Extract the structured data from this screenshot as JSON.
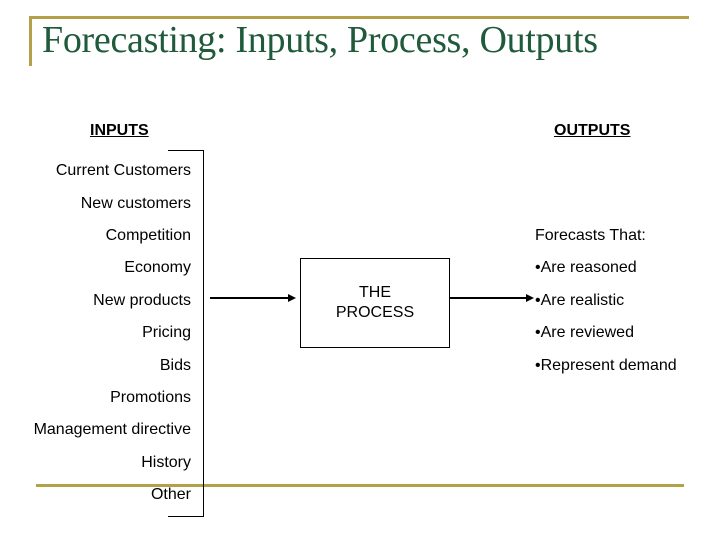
{
  "title": "Forecasting: Inputs, Process, Outputs",
  "inputs": {
    "heading": "INPUTS",
    "items": [
      "Current Customers",
      "New customers",
      "Competition",
      "Economy",
      "New products",
      "Pricing",
      "Bids",
      "Promotions",
      "Management directive",
      "History",
      "Other"
    ]
  },
  "process": {
    "line1": "THE",
    "line2": "PROCESS"
  },
  "outputs": {
    "heading": "OUTPUTS",
    "intro": "Forecasts That:",
    "items": [
      "•Are reasoned",
      "•Are realistic",
      "•Are reviewed",
      "•Represent demand"
    ]
  },
  "colors": {
    "accent_gold": "#b4a04a",
    "title_green": "#1f5a3a"
  }
}
